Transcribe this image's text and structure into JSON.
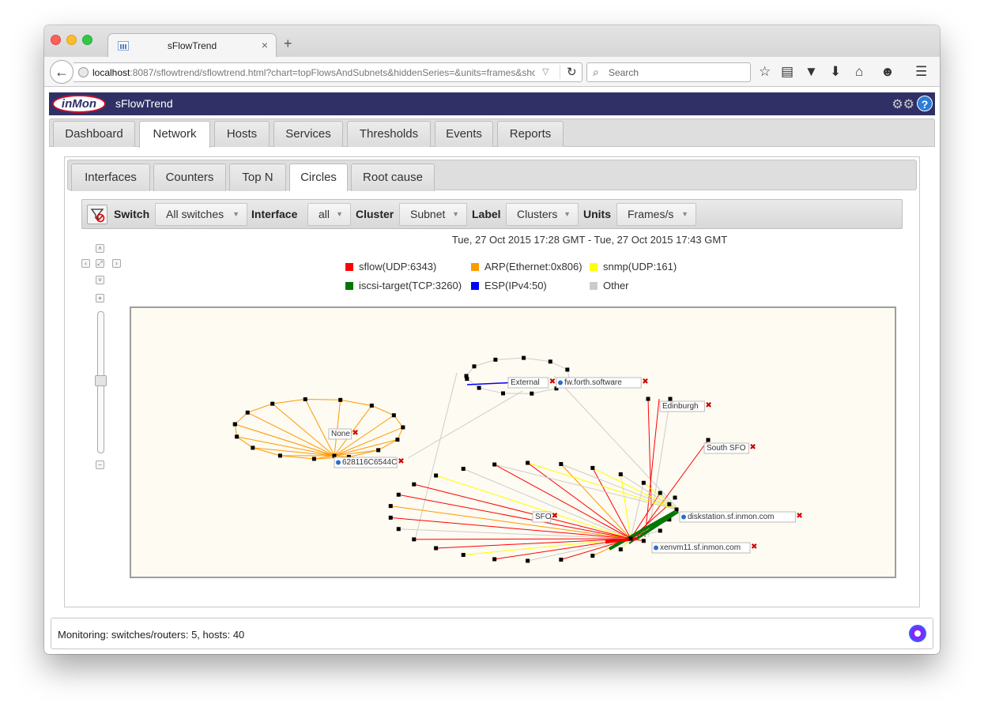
{
  "browser": {
    "tab_title": "sFlowTrend",
    "tab_close": "×",
    "new_tab": "+",
    "url_host": "localhost",
    "url_rest": ":8087/sflowtrend/sflowtrend.html?chart=topFlowsAndSubnets&hiddenSeries=&units=frames&sho",
    "search_placeholder": "Search"
  },
  "app": {
    "logo_text": "inMon",
    "title": "sFlowTrend",
    "help_label": "?"
  },
  "main_tabs": [
    {
      "label": "Dashboard"
    },
    {
      "label": "Network"
    },
    {
      "label": "Hosts"
    },
    {
      "label": "Services"
    },
    {
      "label": "Thresholds"
    },
    {
      "label": "Events"
    },
    {
      "label": "Reports"
    }
  ],
  "sub_tabs": [
    {
      "label": "Interfaces"
    },
    {
      "label": "Counters"
    },
    {
      "label": "Top N"
    },
    {
      "label": "Circles"
    },
    {
      "label": "Root cause"
    }
  ],
  "toolbar": {
    "switch_label": "Switch",
    "switch_value": "All switches",
    "interface_label": "Interface",
    "interface_value": "all",
    "cluster_label": "Cluster",
    "cluster_value": "Subnet",
    "label_label": "Label",
    "label_value": "Clusters",
    "units_label": "Units",
    "units_value": "Frames/s"
  },
  "time_range": "Tue, 27 Oct 2015 17:28 GMT - Tue, 27 Oct 2015 17:43 GMT",
  "legend": [
    {
      "name": "sflow(UDP:6343)",
      "color": "#ff0000"
    },
    {
      "name": "ARP(Ethernet:0x806)",
      "color": "#ff9900"
    },
    {
      "name": "snmp(UDP:161)",
      "color": "#ffff00"
    },
    {
      "name": "iscsi-target(TCP:3260)",
      "color": "#007700"
    },
    {
      "name": "ESP(IPv4:50)",
      "color": "#0000ff"
    },
    {
      "name": "Other",
      "color": "#cccccc"
    }
  ],
  "graph": {
    "clusters": [
      "None",
      "External",
      "Edinburgh",
      "South SFO",
      "SFO"
    ],
    "hosts": [
      "628116C6544C",
      "fw.forth.software",
      "diskstation.sf.inmon.com",
      "xenvm11.sf.inmon.com"
    ]
  },
  "status": {
    "text": "Monitoring: switches/routers: 5, hosts: 40"
  }
}
